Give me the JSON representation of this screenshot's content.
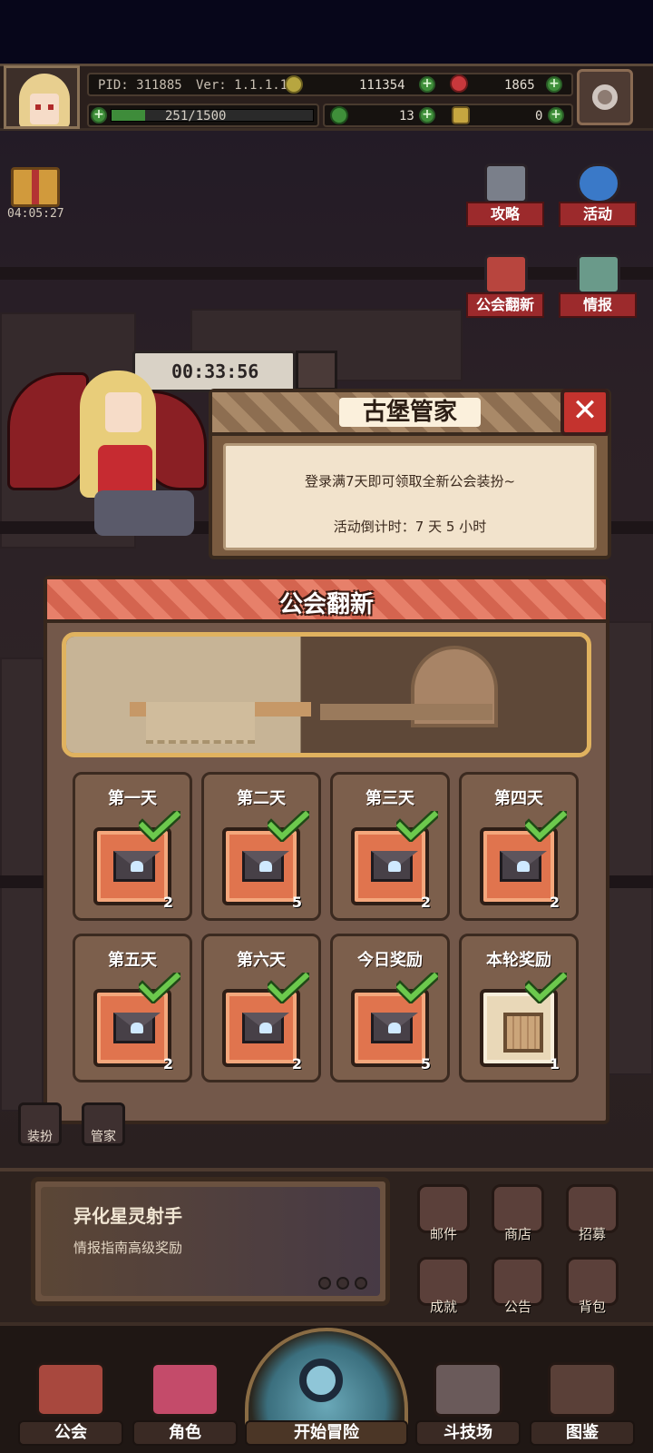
{
  "topbar": {
    "pid": "PID: 311885",
    "version": "Ver: 1.1.1.13",
    "gold": "111354",
    "gems": "1865",
    "exp": "251/1500",
    "clover": "13",
    "item": "0",
    "exp_fraction": 0.167
  },
  "gift": {
    "timer": "04:05:27"
  },
  "side_buttons": {
    "guide": "攻略",
    "event": "活动",
    "renovation": "公会翻新",
    "intel": "情报"
  },
  "scene": {
    "timer": "00:33:56"
  },
  "dialog": {
    "title": "古堡管家",
    "line1": "登录满7天即可领取全新公会装扮~",
    "line2": "活动倒计时：7 天 5 小时"
  },
  "panel": {
    "title": "公会翻新",
    "days": [
      {
        "label": "第一天",
        "count": "2",
        "reward": "envelope",
        "claimed": true
      },
      {
        "label": "第二天",
        "count": "5",
        "reward": "envelope",
        "claimed": true
      },
      {
        "label": "第三天",
        "count": "2",
        "reward": "envelope",
        "claimed": true
      },
      {
        "label": "第四天",
        "count": "2",
        "reward": "envelope",
        "claimed": true
      },
      {
        "label": "第五天",
        "count": "2",
        "reward": "envelope",
        "claimed": true
      },
      {
        "label": "第六天",
        "count": "2",
        "reward": "envelope",
        "claimed": true
      },
      {
        "label": "今日奖励",
        "count": "5",
        "reward": "envelope",
        "claimed": true
      },
      {
        "label": "本轮奖励",
        "count": "1",
        "reward": "crate",
        "claimed": true
      }
    ]
  },
  "small_buttons": {
    "outfit": "装扮",
    "butler": "管家"
  },
  "promo": {
    "title": "异化星灵射手",
    "subtitle": "情报指南高级奖励"
  },
  "hud": {
    "mail": "邮件",
    "shop": "商店",
    "recruit": "招募",
    "achievement": "成就",
    "notice": "公告",
    "backpack": "背包"
  },
  "nav": {
    "guild": "公会",
    "character": "角色",
    "start": "开始冒险",
    "arena": "斗技场",
    "codex": "图鉴"
  },
  "colors": {
    "accent_green": "#6cc94d",
    "ribbon_red": "#9c2a2c",
    "panel_brown": "#73584a",
    "title_salmon": "#e7806a"
  }
}
